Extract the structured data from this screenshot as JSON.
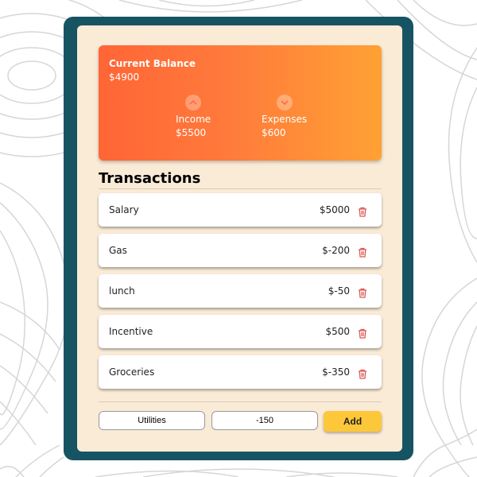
{
  "balance": {
    "title": "Current Balance",
    "amount": "$4900",
    "income": {
      "label": "Income",
      "value": "$5500",
      "icon": "chevron-up-icon"
    },
    "expenses": {
      "label": "Expenses",
      "value": "$600",
      "icon": "chevron-down-icon"
    }
  },
  "transactions": {
    "title": "Transactions",
    "items": [
      {
        "name": "Salary",
        "amount": "$5000"
      },
      {
        "name": "Gas",
        "amount": "$-200"
      },
      {
        "name": "lunch",
        "amount": "$-50"
      },
      {
        "name": "Incentive",
        "amount": "$500"
      },
      {
        "name": "Groceries",
        "amount": "$-350"
      }
    ],
    "delete_icon": "trash-icon"
  },
  "form": {
    "name_value": "Utilities",
    "amount_value": "-150",
    "add_label": "Add"
  },
  "colors": {
    "frame": "#175463",
    "panel": "#faebd7",
    "card_gradient_start": "#ff6536",
    "card_gradient_end": "#ffa134",
    "add_button": "#fcc83a",
    "delete_icon": "#d9534f"
  }
}
